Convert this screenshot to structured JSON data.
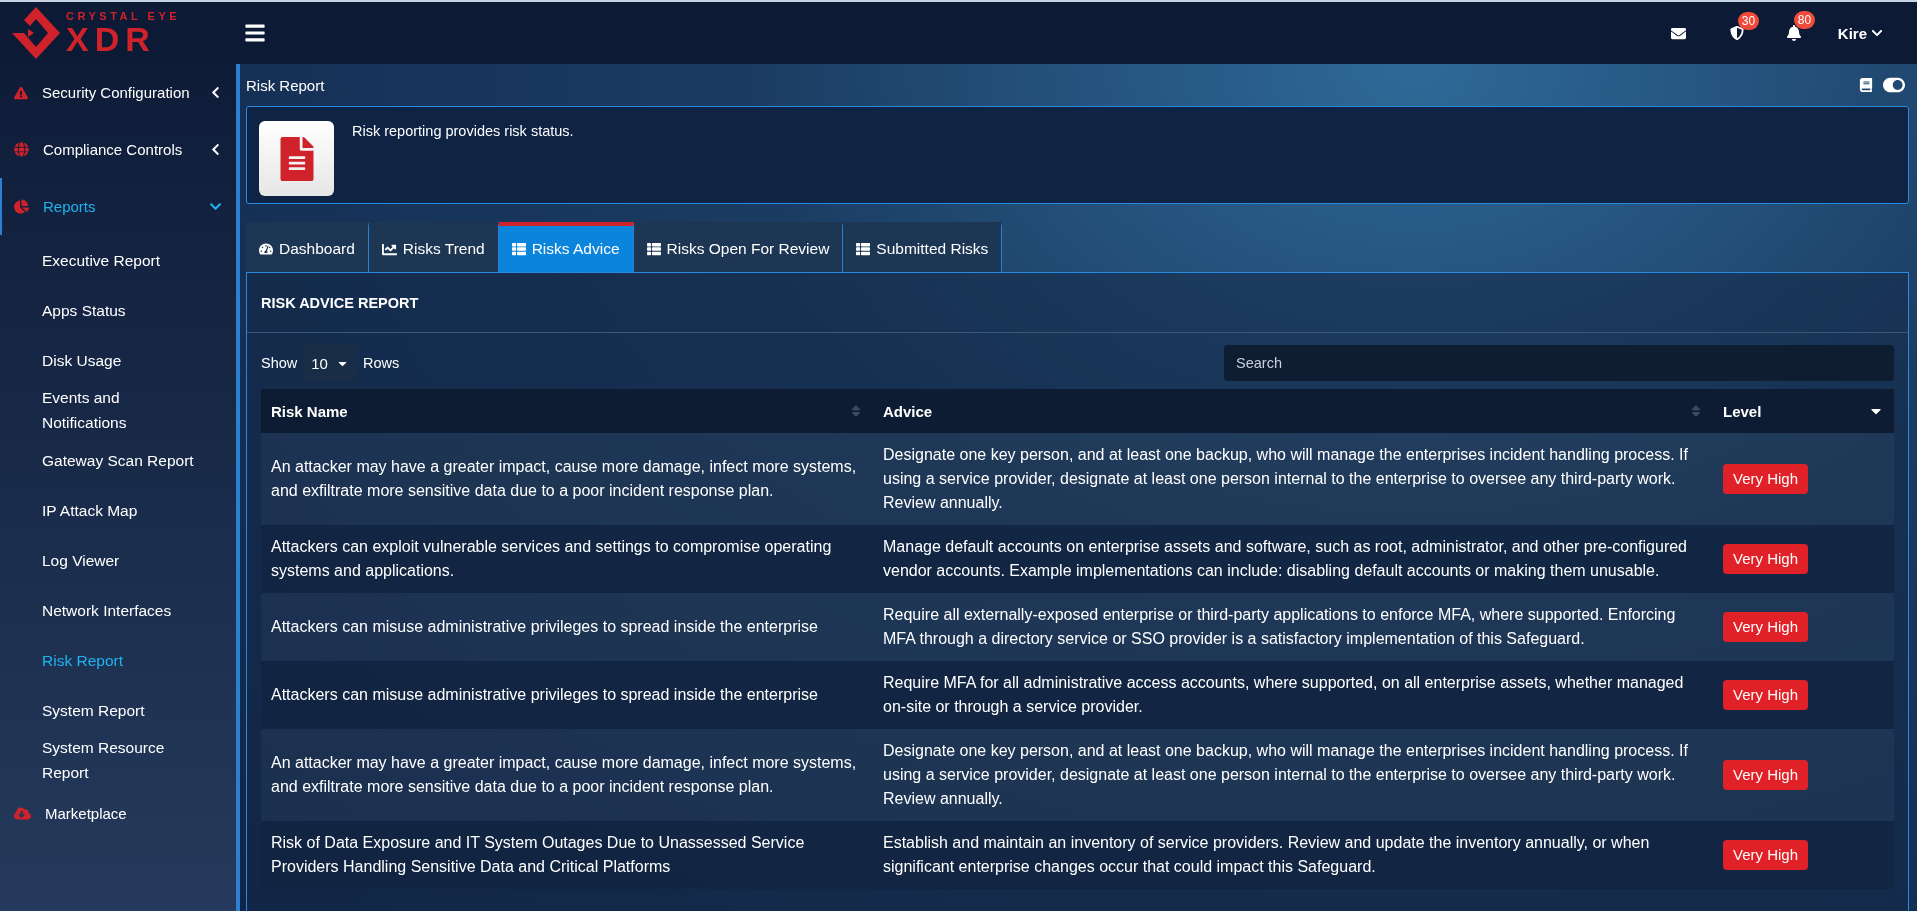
{
  "logo": {
    "top": "CRYSTAL EYE",
    "bottom": "XDR"
  },
  "topbar": {
    "shield_count": "30",
    "bell_count": "80",
    "user": "Kire"
  },
  "sidebar": {
    "items": [
      {
        "kind": "security",
        "label": "Security Configuration",
        "expanded": false
      },
      {
        "kind": "compliance",
        "label": "Compliance Controls",
        "expanded": false
      },
      {
        "kind": "reports",
        "label": "Reports",
        "expanded": true,
        "children": [
          {
            "label": "Executive Report",
            "selected": false
          },
          {
            "label": "Apps Status",
            "selected": false
          },
          {
            "label": "Disk Usage",
            "selected": false
          },
          {
            "label": "Events and Notifications",
            "selected": false
          },
          {
            "label": "Gateway Scan Report",
            "selected": false
          },
          {
            "label": "IP Attack Map",
            "selected": false
          },
          {
            "label": "Log Viewer",
            "selected": false
          },
          {
            "label": "Network Interfaces",
            "selected": false
          },
          {
            "label": "Risk Report",
            "selected": true
          },
          {
            "label": "System Report",
            "selected": false
          },
          {
            "label": "System Resource Report",
            "selected": false
          }
        ]
      },
      {
        "kind": "marketplace",
        "label": "Marketplace",
        "expanded": false
      }
    ]
  },
  "page": {
    "title": "Risk Report",
    "toggle_on": true,
    "description": "Risk reporting provides risk status."
  },
  "tabs": [
    {
      "kind": "dashboard",
      "label": "Dashboard",
      "selected": false
    },
    {
      "kind": "trend",
      "label": "Risks Trend",
      "selected": false
    },
    {
      "kind": "list",
      "label": "Risks Advice",
      "selected": true
    },
    {
      "kind": "list",
      "label": "Risks Open For Review",
      "selected": false
    },
    {
      "kind": "list",
      "label": "Submitted Risks",
      "selected": false
    }
  ],
  "report": {
    "title": "RISK ADVICE REPORT",
    "show_label": "Show",
    "rows_value": "10",
    "rows_label": "Rows",
    "search_placeholder": "Search"
  },
  "table": {
    "columns": [
      {
        "label": "Risk Name",
        "sorted": false
      },
      {
        "label": "Advice",
        "sorted": false
      },
      {
        "label": "Level",
        "sorted": true
      }
    ],
    "rows": [
      {
        "risk": "An attacker may have a greater impact, cause more damage, infect more systems, and exfiltrate more sensitive data due to a poor incident response plan.",
        "advice": "Designate one key person, and at least one backup, who will manage the enterprises incident handling process. If using a service provider, designate at least one person internal to the enterprise to oversee any third-party work. Review annually.",
        "level": "Very High"
      },
      {
        "risk": "Attackers can exploit vulnerable services and settings to compromise operating systems and applications.",
        "advice": "Manage default accounts on enterprise assets and software, such as root, administrator, and other pre-configured vendor accounts. Example implementations can include: disabling default accounts or making them unusable.",
        "level": "Very High"
      },
      {
        "risk": "Attackers can misuse administrative privileges to spread inside the enterprise",
        "advice": "Require all externally-exposed enterprise or third-party applications to enforce MFA, where supported. Enforcing MFA through a directory service or SSO provider is a satisfactory implementation of this Safeguard.",
        "level": "Very High"
      },
      {
        "risk": "Attackers can misuse administrative privileges to spread inside the enterprise",
        "advice": "Require MFA for all administrative access accounts, where supported, on all enterprise assets, whether managed on-site or through a service provider.",
        "level": "Very High"
      },
      {
        "risk": "An attacker may have a greater impact, cause more damage, infect more systems, and exfiltrate more sensitive data due to a poor incident response plan.",
        "advice": "Designate one key person, and at least one backup, who will manage the enterprises incident handling process. If using a service provider, designate at least one person internal to the enterprise to oversee any third-party work. Review annually.",
        "level": "Very High"
      },
      {
        "risk": "Risk of Data Exposure and IT System Outages Due to Unassessed Service Providers Handling Sensitive Data and Critical Platforms",
        "advice": "Establish and maintain an inventory of service providers. Review and update the inventory annually, or when significant enterprise changes occur that could impact this Safeguard.",
        "level": "Very High"
      }
    ]
  }
}
